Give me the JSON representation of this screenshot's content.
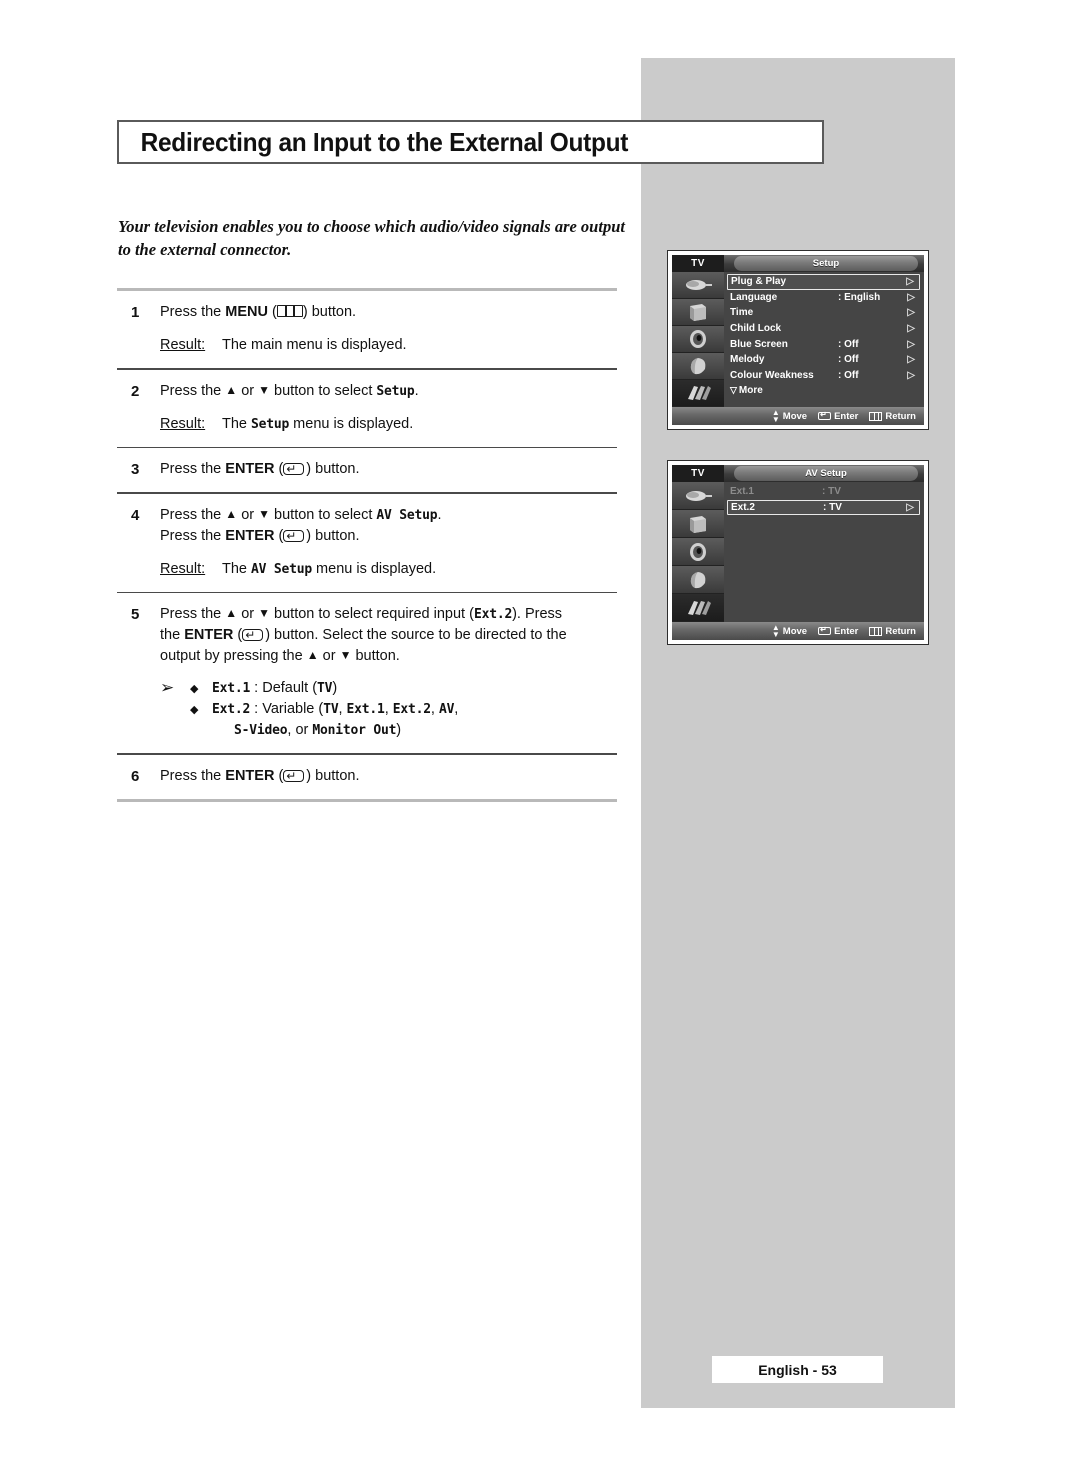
{
  "page": {
    "title": "Redirecting an Input to the External Output",
    "intro": "Your television enables you to choose which audio/video signals are output to the external connector.",
    "footer": "English - 53"
  },
  "steps": [
    {
      "number": "1",
      "lines": [
        "Press the ",
        "MENU",
        " (",
        "menu-icon",
        ") button."
      ],
      "text_before_bold": "Press the ",
      "bold": "MENU",
      "text_after_icon": ") button.",
      "result_label": "Result:",
      "result_text": "The main menu is displayed."
    },
    {
      "number": "2",
      "text_a": "Press the ",
      "text_b": " or ",
      "text_c": " button to select ",
      "mono_target": "Setup",
      "text_d": ".",
      "result_label": "Result:",
      "result_a": "The ",
      "result_mono": "Setup",
      "result_b": " menu is displayed."
    },
    {
      "number": "3",
      "text_before_bold": "Press the ",
      "bold": "ENTER",
      "text_after_icon": ") button."
    },
    {
      "number": "4",
      "l1_a": "Press the ",
      "l1_b": " or ",
      "l1_c": " button to select ",
      "l1_mono": "AV Setup",
      "l1_d": ".",
      "l2_a": "Press the ",
      "l2_bold": "ENTER",
      "l2_b": ") button.",
      "result_label": "Result:",
      "result_a": "The ",
      "result_mono": "AV Setup",
      "result_b": " menu is displayed."
    },
    {
      "number": "5",
      "l1_a": "Press the ",
      "l1_b": " or ",
      "l1_c": " button to select required input (",
      "l1_mono": "Ext.2",
      "l1_d": "). Press",
      "l2_a": "the ",
      "l2_bold": "ENTER",
      "l2_b": ") button. Select the source to be directed to the",
      "l3": "output by pressing the ",
      "l3_b": " or ",
      "l3_c": " button.",
      "note_arrow": "➢",
      "notes": [
        {
          "bullet": "◆",
          "mono": "Ext.1",
          "sep": " : ",
          "plain": "Default (",
          "mono2": "TV",
          "tail": ")"
        },
        {
          "bullet": "◆",
          "mono": "Ext.2",
          "sep": " : ",
          "plain": "Variable (",
          "mono2": "TV",
          "m3": "Ext.1",
          "m4": "Ext.2",
          "m5": "AV",
          "tail": ","
        }
      ],
      "note_cont_mono": "S-Video",
      "note_cont_mid": ", or ",
      "note_cont_mono2": "Monitor Out",
      "note_cont_tail": ")"
    },
    {
      "number": "6",
      "text_before_bold": "Press the ",
      "bold": "ENTER",
      "text_after_icon": ") button."
    }
  ],
  "osd_setup": {
    "tv_label": "TV",
    "title": "Setup",
    "rows": [
      {
        "label": "Plug & Play",
        "value": "",
        "chevron": "▷",
        "selected": true,
        "dim": false
      },
      {
        "label": "Language",
        "value": ": English",
        "chevron": "▷",
        "selected": false,
        "dim": false
      },
      {
        "label": "Time",
        "value": "",
        "chevron": "▷",
        "selected": false,
        "dim": false
      },
      {
        "label": "Child Lock",
        "value": "",
        "chevron": "▷",
        "selected": false,
        "dim": false
      },
      {
        "label": "Blue Screen",
        "value": ": Off",
        "chevron": "▷",
        "selected": false,
        "dim": false
      },
      {
        "label": "Melody",
        "value": ": Off",
        "chevron": "▷",
        "selected": false,
        "dim": false
      },
      {
        "label": "Colour Weakness",
        "value": ": Off",
        "chevron": "▷",
        "selected": false,
        "dim": false
      }
    ],
    "more_label": "More",
    "more_glyph": "▽",
    "bottom": {
      "move": "Move",
      "enter": "Enter",
      "return": "Return"
    }
  },
  "osd_av": {
    "tv_label": "TV",
    "title": "AV Setup",
    "rows": [
      {
        "label": "Ext.1",
        "value": ": TV",
        "chevron": "",
        "selected": false,
        "dim": true
      },
      {
        "label": "Ext.2",
        "value": ": TV",
        "chevron": "▷",
        "selected": true,
        "dim": false
      }
    ],
    "bottom": {
      "move": "Move",
      "enter": "Enter",
      "return": "Return"
    }
  },
  "colors": {
    "gray_column": "#cbcbcb",
    "osd_bg": "#454545",
    "osd_rail": "#3b3b3b",
    "title_border": "#5a5a5a"
  }
}
